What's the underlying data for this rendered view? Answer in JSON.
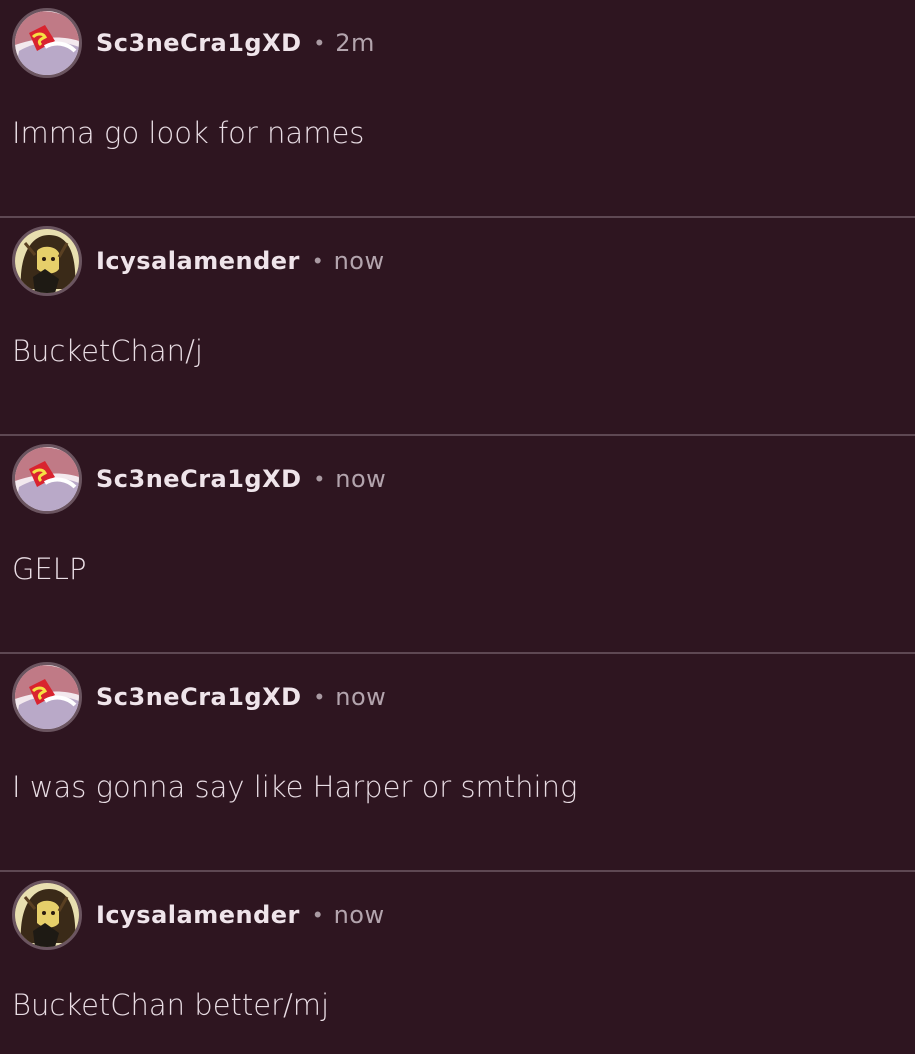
{
  "messages": [
    {
      "username": "Sc3neCra1gXD",
      "time": "2m",
      "text": "Imma go look for names",
      "avatar_icon": "scene-craig-avatar"
    },
    {
      "username": "Icysalamender",
      "time": "now",
      "text": "BucketChan/j",
      "avatar_icon": "icysalamender-avatar"
    },
    {
      "username": "Sc3neCra1gXD",
      "time": "now",
      "text": "GELP",
      "avatar_icon": "scene-craig-avatar"
    },
    {
      "username": "Sc3neCra1gXD",
      "time": "now",
      "text": "I was gonna say like Harper or smthing",
      "avatar_icon": "scene-craig-avatar"
    },
    {
      "username": "Icysalamender",
      "time": "now",
      "text": "BucketChan better/mj",
      "avatar_icon": "icysalamender-avatar"
    }
  ],
  "separator": "•",
  "colors": {
    "background": "#2e1520",
    "divider": "#5e4853",
    "username": "#efe4ea",
    "timestamp": "#b3a4ad"
  }
}
